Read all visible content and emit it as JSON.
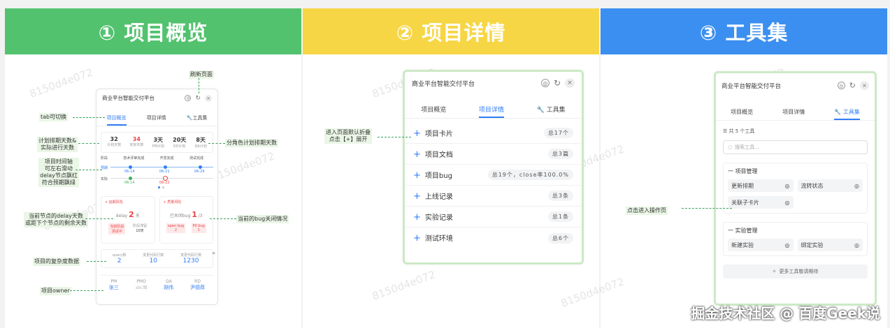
{
  "columns": [
    {
      "title": "① 项目概览"
    },
    {
      "title": "② 项目详情"
    },
    {
      "title": "③ 工具集"
    }
  ],
  "panel": {
    "title": "商业平台智能交付平台",
    "tabs": [
      "项目概览",
      "项目详情",
      "工具集"
    ]
  },
  "overview": {
    "stats": [
      {
        "value": "32",
        "label": "计划天数"
      },
      {
        "value": "34",
        "label": "实际天数"
      },
      {
        "value": "3天",
        "label": "PM计划"
      },
      {
        "value": "20天",
        "label": "RD计划"
      },
      {
        "value": "8天",
        "label": "QA计划"
      }
    ],
    "stages": [
      "阶段",
      "技术评审完成",
      "开发完成",
      "测试完成"
    ],
    "plan_label": "预期",
    "actual_label": "实际",
    "plan_dates": [
      "06-14",
      "06-21",
      "06-29"
    ],
    "actual_dates": [
      "06-14",
      "06-22"
    ],
    "delay_card": {
      "title": "+ 延期风险",
      "text": "delay",
      "value": "2",
      "unit": "天",
      "sub": [
        {
          "label": "当前阶段",
          "value": "测试中"
        },
        {
          "label": "阶段滞留",
          "value": "10天"
        }
      ]
    },
    "bug_card": {
      "title": "+ 质量风险",
      "text": "已关闭bug",
      "value": "1",
      "unit": "/3",
      "sub": [
        {
          "label": "open bug",
          "value": "2"
        },
        {
          "label": "P0 bug",
          "value": "1"
        }
      ]
    },
    "complexity": [
      {
        "label": "query数",
        "value": "2"
      },
      {
        "label": "变更代码行数",
        "value": "10"
      },
      {
        "label": "变更代码行数",
        "value": "1230"
      }
    ],
    "owners": [
      {
        "role": "PM",
        "name": "张三"
      },
      {
        "role": "PMO",
        "name": "abc图"
      },
      {
        "role": "QA",
        "name": "刚伟"
      },
      {
        "role": "RD",
        "name": "尹德荐"
      }
    ]
  },
  "annotations": {
    "refresh": "刷新页面",
    "tab_switch": "tab可切换",
    "plan_days": "计划排期天数&\n实际进行天数",
    "role_days": "分角色计划排期天数",
    "timeline": "项目时间轴\n可左右滑动\ndelay节点飘红\n符合预期飘绿",
    "delay_node": "当前节点的delay天数\n或距下个节点的剩余天数",
    "bug_status": "当前的bug关闭情况",
    "complexity": "项目的复杂度数据",
    "owner": "项目owner",
    "expand": "进入页面默认折叠\n点击【+】展开",
    "enter_op": "点击进入操作页"
  },
  "details": [
    {
      "label": "项目卡片",
      "count": "总17个"
    },
    {
      "label": "项目文档",
      "count": "总3篇"
    },
    {
      "label": "项目bug",
      "count": "总19个，close率100.0%"
    },
    {
      "label": "上线记录",
      "count": "总3条"
    },
    {
      "label": "实验记录",
      "count": "总1条"
    },
    {
      "label": "测试环境",
      "count": "总6个"
    }
  ],
  "tools": {
    "count_text": "共 5 个工具",
    "search_placeholder": "搜索工具...",
    "groups": [
      {
        "title": "一 项目管理",
        "items": [
          "更新排期",
          "流转状态",
          "关联子卡片"
        ]
      },
      {
        "title": "一 实验管理",
        "items": [
          "新建实验",
          "绑定实验"
        ]
      }
    ],
    "more": "更多工具敬请期待"
  },
  "watermark": "8150d4e072",
  "footer": "掘金技术社区 @ 百度Geek说"
}
